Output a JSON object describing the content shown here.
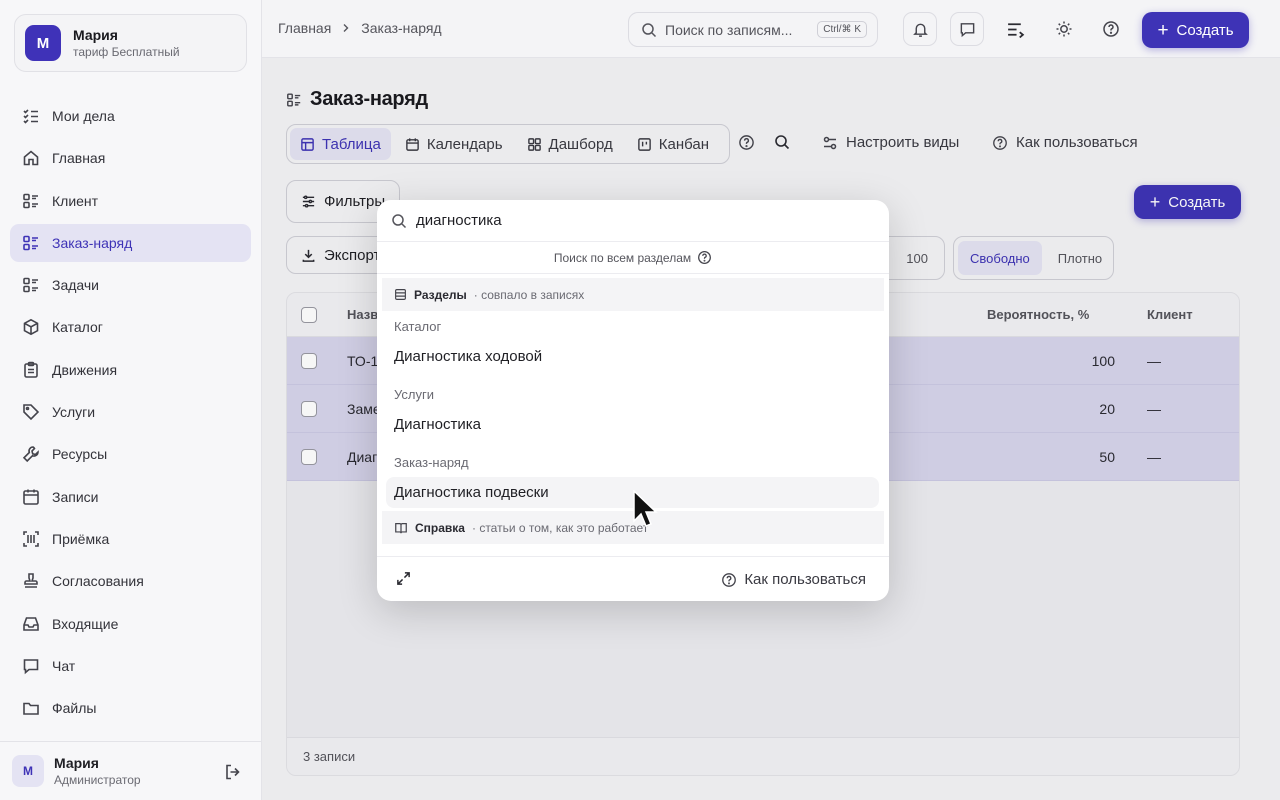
{
  "account": {
    "initial": "М",
    "name": "Мария",
    "plan": "тариф Бесплатный"
  },
  "nav": [
    {
      "label": "Мои дела",
      "icon": "checklist-icon",
      "active": false
    },
    {
      "label": "Главная",
      "icon": "home-icon",
      "active": false
    },
    {
      "label": "Клиент",
      "icon": "list-icon",
      "active": false
    },
    {
      "label": "Заказ-наряд",
      "icon": "list-icon",
      "active": true
    },
    {
      "label": "Задачи",
      "icon": "list-icon",
      "active": false
    },
    {
      "label": "Каталог",
      "icon": "box-icon",
      "active": false
    },
    {
      "label": "Движения",
      "icon": "clipboard-icon",
      "active": false
    },
    {
      "label": "Услуги",
      "icon": "tag-icon",
      "active": false
    },
    {
      "label": "Ресурсы",
      "icon": "wrench-icon",
      "active": false
    },
    {
      "label": "Записи",
      "icon": "calendar-icon",
      "active": false
    },
    {
      "label": "Приёмка",
      "icon": "barcode-icon",
      "active": false
    },
    {
      "label": "Согласования",
      "icon": "stamp-icon",
      "active": false
    },
    {
      "label": "Входящие",
      "icon": "inbox-icon",
      "active": false
    },
    {
      "label": "Чат",
      "icon": "chat-icon",
      "active": false
    },
    {
      "label": "Файлы",
      "icon": "folder-icon",
      "active": false
    }
  ],
  "user": {
    "initial": "М",
    "name": "Мария",
    "role": "Администратор"
  },
  "breadcrumb": {
    "home": "Главная",
    "current": "Заказ-наряд"
  },
  "topbar": {
    "search_placeholder": "Поиск по записям...",
    "shortcut": "Ctrl/⌘ K",
    "create_label": "Создать"
  },
  "page": {
    "title": "Заказ-наряд"
  },
  "views": {
    "tabs": [
      "Таблица",
      "Календарь",
      "Дашборд",
      "Канбан"
    ],
    "configure": "Настроить виды",
    "how_to": "Как пользоваться"
  },
  "toolbar": {
    "filters": "Фильтры",
    "create": "Создать",
    "export": "Экспорт",
    "page_size": "100",
    "density": [
      "Свободно",
      "Плотно"
    ]
  },
  "table": {
    "columns": [
      "Назв",
      "Вероятность, %",
      "Клиент"
    ],
    "rows": [
      {
        "name": "ТО-1",
        "probability": "100",
        "client": "—"
      },
      {
        "name": "Заме",
        "probability": "20",
        "client": "—"
      },
      {
        "name": "Диаг",
        "probability": "50",
        "client": "—"
      }
    ],
    "footer": "3 записи"
  },
  "modal": {
    "query": "диагностика",
    "scope": "Поиск по всем разделам",
    "sections_head": {
      "title": "Разделы",
      "hint": "· совпало в записях"
    },
    "groups": [
      {
        "label": "Каталог",
        "item": "Диагностика ходовой"
      },
      {
        "label": "Услуги",
        "item": "Диагностика"
      },
      {
        "label": "Заказ-наряд",
        "item": "Диагностика подвески"
      }
    ],
    "help_head": {
      "title": "Справка",
      "hint": "· статьи о том, как это работает"
    },
    "footer_help": "Как пользоваться"
  }
}
